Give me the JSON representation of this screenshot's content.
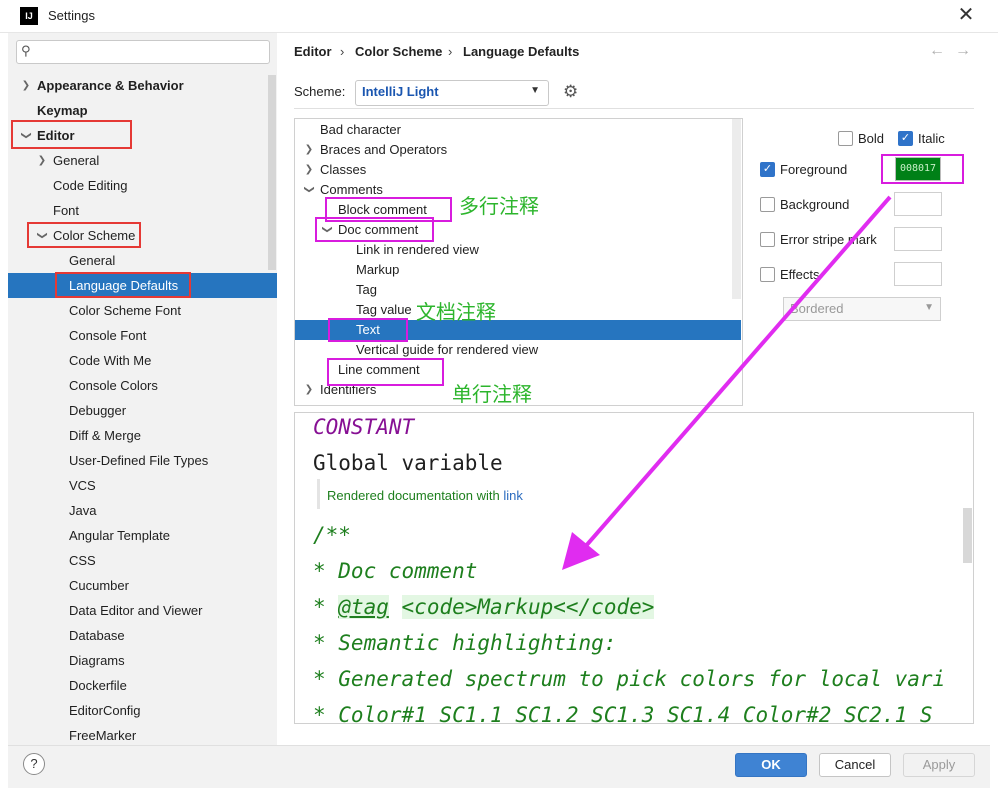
{
  "window": {
    "title": "Settings",
    "logo": "IJ"
  },
  "search": {
    "placeholder": ""
  },
  "sidebar": {
    "items": [
      {
        "label": "Appearance & Behavior"
      },
      {
        "label": "Keymap"
      },
      {
        "label": "Editor"
      },
      {
        "label": "General"
      },
      {
        "label": "Code Editing"
      },
      {
        "label": "Font"
      },
      {
        "label": "Color Scheme"
      },
      {
        "label": "General"
      },
      {
        "label": "Language Defaults"
      },
      {
        "label": "Color Scheme Font"
      },
      {
        "label": "Console Font"
      },
      {
        "label": "Code With Me"
      },
      {
        "label": "Console Colors"
      },
      {
        "label": "Debugger"
      },
      {
        "label": "Diff & Merge"
      },
      {
        "label": "User-Defined File Types"
      },
      {
        "label": "VCS"
      },
      {
        "label": "Java"
      },
      {
        "label": "Angular Template"
      },
      {
        "label": "CSS"
      },
      {
        "label": "Cucumber"
      },
      {
        "label": "Data Editor and Viewer"
      },
      {
        "label": "Database"
      },
      {
        "label": "Diagrams"
      },
      {
        "label": "Dockerfile"
      },
      {
        "label": "EditorConfig"
      },
      {
        "label": "FreeMarker"
      }
    ]
  },
  "breadcrumb": [
    "Editor",
    "Color Scheme",
    "Language Defaults"
  ],
  "scheme": {
    "label": "Scheme:",
    "value": "IntelliJ Light"
  },
  "elements": [
    {
      "label": "Bad character"
    },
    {
      "label": "Braces and Operators"
    },
    {
      "label": "Classes"
    },
    {
      "label": "Comments"
    },
    {
      "label": "Block comment"
    },
    {
      "label": "Doc comment"
    },
    {
      "label": "Link in rendered view"
    },
    {
      "label": "Markup"
    },
    {
      "label": "Tag"
    },
    {
      "label": "Tag value"
    },
    {
      "label": "Text"
    },
    {
      "label": "Vertical guide for rendered view"
    },
    {
      "label": "Line comment"
    },
    {
      "label": "Identifiers"
    }
  ],
  "annotations": {
    "block": "多行注释",
    "doc": "文档注释",
    "line": "单行注释"
  },
  "attributes": {
    "bold": "Bold",
    "italic": "Italic",
    "foreground": "Foreground",
    "foreground_value": "008017",
    "background": "Background",
    "error_stripe": "Error stripe mark",
    "effects": "Effects",
    "effects_value": "Bordered"
  },
  "preview": {
    "constant": "CONSTANT",
    "global_var": "Global variable",
    "rendered_doc": "Rendered documentation with",
    "link": "link",
    "doc_open": "/**",
    "line1": " * Doc comment",
    "line2_star": " * ",
    "line2_tag": "@tag",
    "line2_code": "<code>Markup<</code>",
    "line3": " * Semantic highlighting:",
    "line4": " * Generated spectrum to pick colors for local vari",
    "line5": " *  Color#1 SC1.1 SC1.2 SC1.3 SC1.4 Color#2 SC2.1 S"
  },
  "buttons": {
    "ok": "OK",
    "cancel": "Cancel",
    "apply": "Apply",
    "help": "?"
  },
  "colors": {
    "accent": "#2675bf",
    "highlight": "#d81cde",
    "comment_green": "#1e7f1e",
    "foreground": "#008017"
  }
}
